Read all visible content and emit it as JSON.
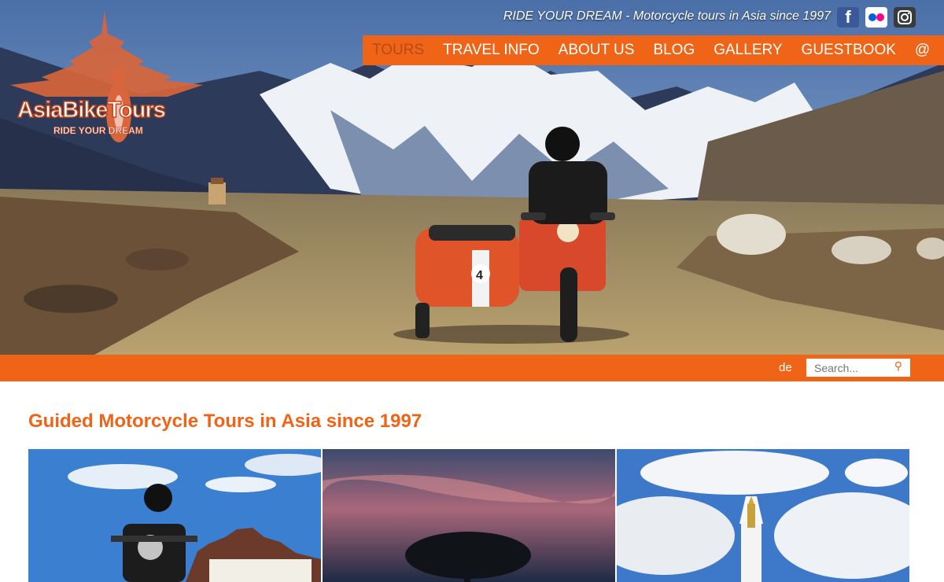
{
  "header": {
    "tagline": "RIDE YOUR DREAM - Motorcycle tours in Asia since 1997",
    "social": [
      {
        "icon": "facebook-icon",
        "glyph": "f"
      },
      {
        "icon": "flickr-icon"
      },
      {
        "icon": "instagram-icon"
      }
    ]
  },
  "logo": {
    "name": "AsiaBikeTours",
    "slogan": "RIDE YOUR DREAM"
  },
  "nav": {
    "items": [
      "TOURS",
      "TRAVEL INFO",
      "ABOUT US",
      "BLOG",
      "GALLERY",
      "GUESTBOOK",
      "@"
    ],
    "active": "TOURS"
  },
  "toolbar": {
    "language": "de",
    "search_placeholder": "Search..."
  },
  "main": {
    "title": "Guided Motorcycle Tours in Asia since 1997"
  },
  "colors": {
    "accent": "#f06418",
    "nav_active": "#b54c15",
    "logo": "#c9461a"
  }
}
